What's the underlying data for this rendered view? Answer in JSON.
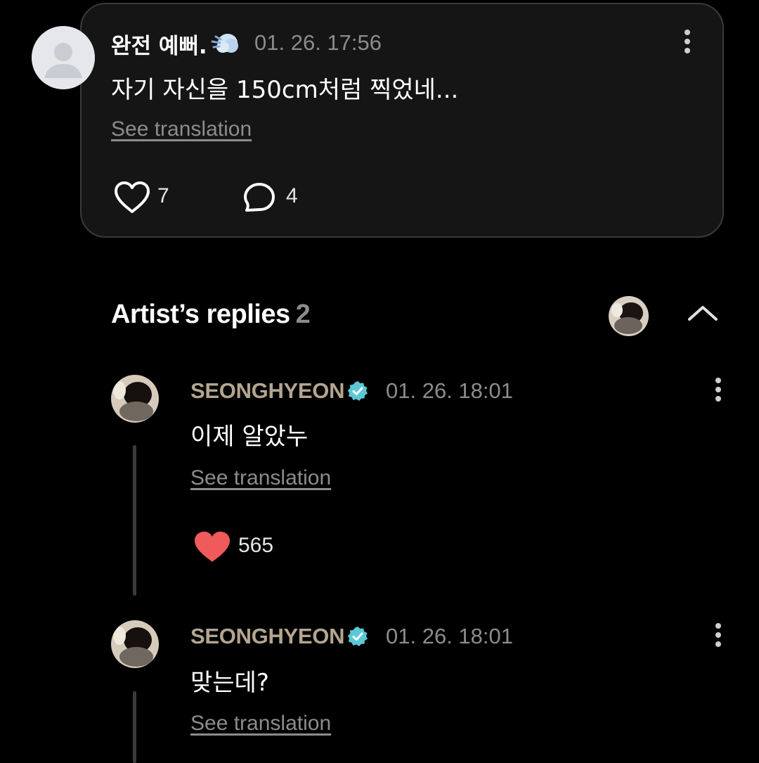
{
  "fan_comment": {
    "username": "완전 예뻐.",
    "emoji_icon": "puff-cloud-emoji",
    "timestamp": "01. 26. 17:56",
    "text": "자기 자신을 150cm처럼 찍었네...",
    "see_translation": "See translation",
    "likes": "7",
    "replies": "4"
  },
  "artist_replies": {
    "title": "Artist’s replies",
    "count": "2"
  },
  "replies": [
    {
      "name": "SEONGHYEON",
      "timestamp": "01. 26. 18:01",
      "text": "이제 알았누",
      "see_translation": "See translation",
      "likes": "565",
      "liked": true
    },
    {
      "name": "SEONGHYEON",
      "timestamp": "01. 26. 18:01",
      "text": "맞는데?",
      "see_translation": "See translation"
    }
  ],
  "colors": {
    "background": "#000000",
    "card": "#151515",
    "artist_name": "#b3a590",
    "verified": "#5bc8d6",
    "heart_filled": "#f05a5a",
    "muted_text": "#8c8c8c"
  }
}
